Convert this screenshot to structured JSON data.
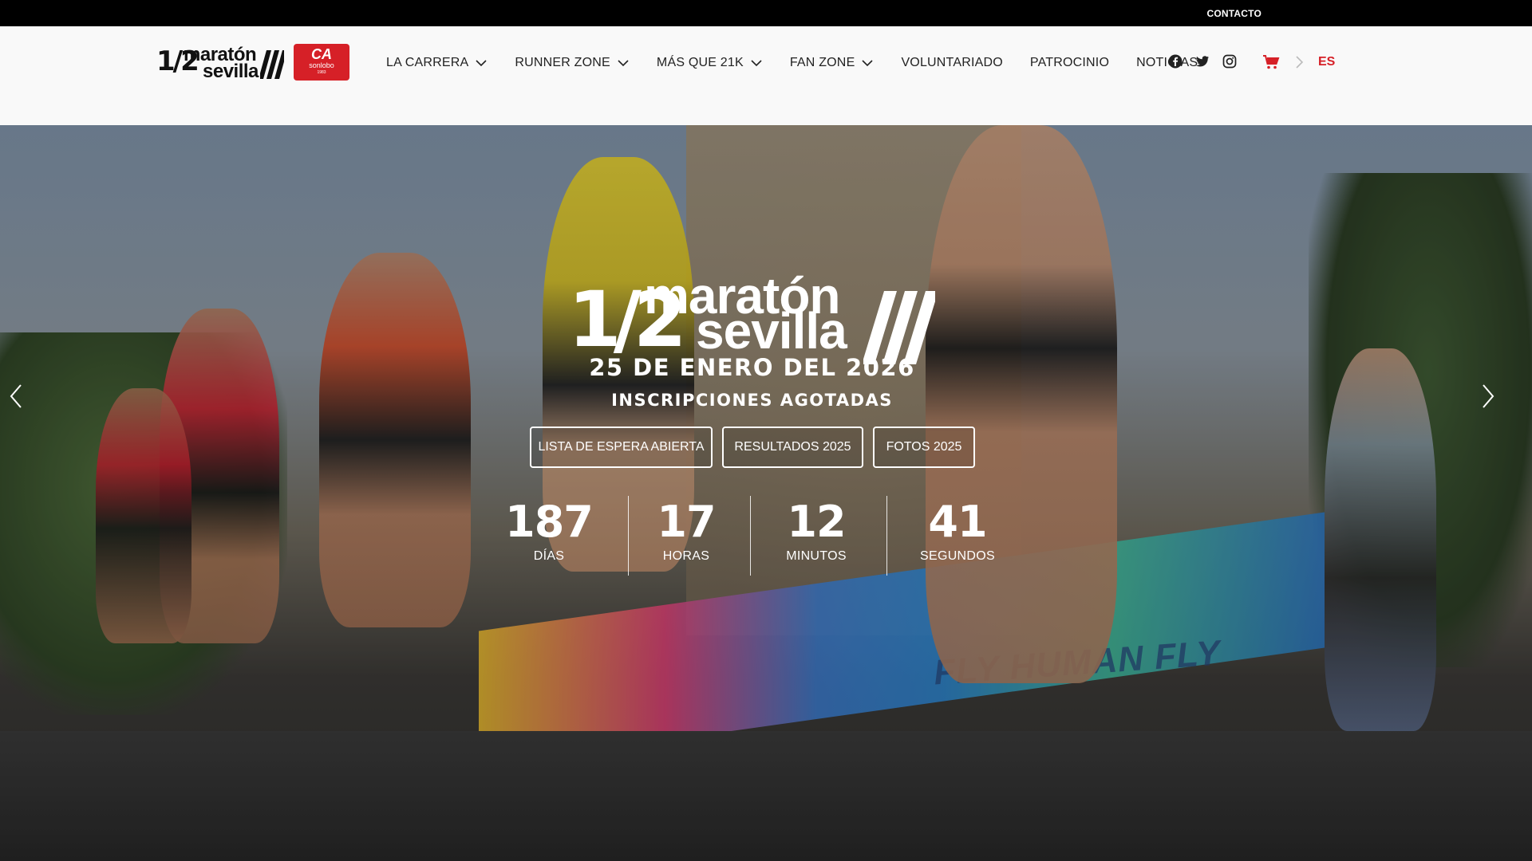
{
  "topbar": {
    "contact": "CONTACTO"
  },
  "header": {
    "logo": {
      "half": "1/2",
      "line1": "maratón",
      "line2": "sevilla"
    },
    "partner_logo": {
      "line1": "CA",
      "line2": "sonlobo",
      "line3": "1983"
    },
    "nav": [
      {
        "label": "LA CARRERA",
        "dropdown": true
      },
      {
        "label": "RUNNER ZONE",
        "dropdown": true
      },
      {
        "label": "MÁS QUE 21K",
        "dropdown": true
      },
      {
        "label": "FAN ZONE",
        "dropdown": true
      },
      {
        "label": "VOLUNTARIADO",
        "dropdown": false
      },
      {
        "label": "PATROCINIO",
        "dropdown": false
      },
      {
        "label": "NOTICIAS",
        "dropdown": false
      }
    ],
    "social_icons": [
      "facebook-icon",
      "twitter-icon",
      "instagram-icon"
    ],
    "cart_icon": "cart-icon",
    "language": "ES",
    "accent_color": "#d62027"
  },
  "hero": {
    "logo": {
      "half": "1/2",
      "line1": "maratón",
      "line2": "sevilla"
    },
    "date": "25 DE ENERO DEL 2026",
    "status": "INSCRIPCIONES AGOTADAS",
    "buttons": [
      {
        "label": "LISTA DE ESPERA ABIERTA"
      },
      {
        "label": "RESULTADOS 2025"
      },
      {
        "label": "FOTOS 2025"
      }
    ],
    "countdown": [
      {
        "value": "187",
        "label": "DÍAS"
      },
      {
        "value": "17",
        "label": "HORAS"
      },
      {
        "value": "12",
        "label": "MINUTOS"
      },
      {
        "value": "41",
        "label": "SEGUNDOS"
      }
    ],
    "banner_text": "FLY HUMAN FLY",
    "prev_icon": "chevron-left-icon",
    "next_icon": "chevron-right-icon"
  }
}
